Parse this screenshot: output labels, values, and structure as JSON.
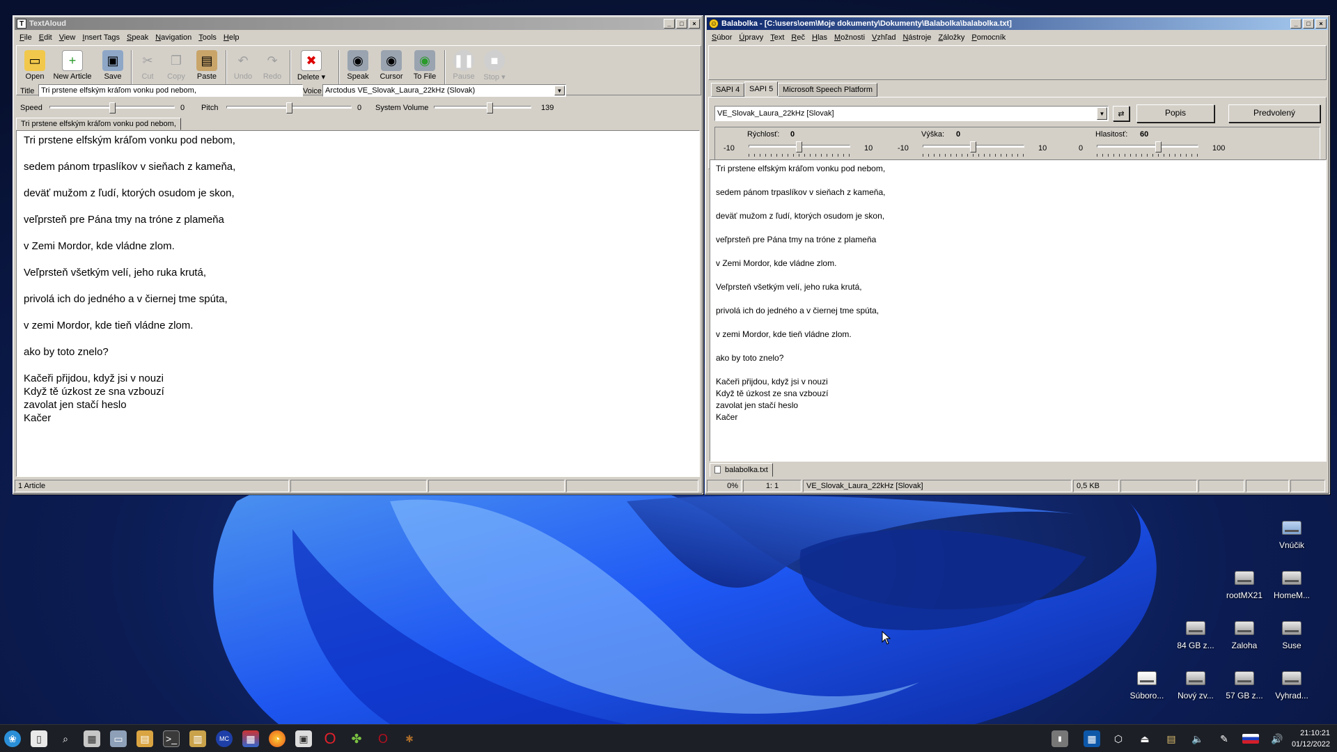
{
  "textaloud": {
    "title": "TextAloud",
    "menu": [
      "File",
      "Edit",
      "View",
      "Insert Tags",
      "Speak",
      "Navigation",
      "Tools",
      "Help"
    ],
    "toolbar": {
      "open": "Open",
      "new_article": "New Article",
      "save": "Save",
      "cut": "Cut",
      "copy": "Copy",
      "paste": "Paste",
      "undo": "Undo",
      "redo": "Redo",
      "delete": "Delete",
      "speak": "Speak",
      "cursor": "Cursor",
      "to_file": "To File",
      "pause": "Pause",
      "stop": "Stop"
    },
    "title_label": "Title",
    "title_value": "Tri prstene elfským kráľom vonku pod nebom,",
    "voice_label": "Voice",
    "voice_value": "Arctodus VE_Slovak_Laura_22kHz (Slovak)",
    "speed_label": "Speed",
    "speed_value": "0",
    "pitch_label": "Pitch",
    "pitch_value": "0",
    "volume_label": "System Volume",
    "volume_value": "139",
    "article_tab": "Tri prstene elfským kráľom vonku pod nebom,",
    "status": "1 Article"
  },
  "balabolka": {
    "title": "Balabolka - [C:\\users\\oem\\Moje dokumenty\\Dokumenty\\Balabolka\\balabolka.txt]",
    "menu": [
      "Súbor",
      "Úpravy",
      "Text",
      "Reč",
      "Hlas",
      "Možnosti",
      "Vzhľad",
      "Nástroje",
      "Záložky",
      "Pomocník"
    ],
    "tabs": [
      "SAPI 4",
      "SAPI 5",
      "Microsoft Speech Platform"
    ],
    "selected_tab": "SAPI 5",
    "voice_value": "VE_Slovak_Laura_22kHz [Slovak]",
    "popis": "Popis",
    "predvoleny": "Predvolený",
    "rychlost_label": "Rýchlosť:",
    "rychlost_value": "0",
    "rychlost_min": "-10",
    "rychlost_max": "10",
    "vyska_label": "Výška:",
    "vyska_value": "0",
    "vyska_min": "-10",
    "vyska_max": "10",
    "hlasitost_label": "Hlasitosť:",
    "hlasitost_value": "60",
    "hlasitost_min": "0",
    "hlasitost_max": "100",
    "doc_tab": "balabolka.txt",
    "status": {
      "percent": "0%",
      "position": "1:   1",
      "voice": "VE_Slovak_Laura_22kHz [Slovak]",
      "size": "0,5 KB"
    }
  },
  "poem": [
    "Tri prstene elfským kráľom vonku pod nebom,",
    "",
    "sedem pánom trpaslíkov v sieňach z kameňa,",
    "",
    "deväť mužom z ľudí, ktorých osudom je skon,",
    "",
    "veľprsteň pre Pána tmy na tróne z plameňa",
    "",
    "v Zemi Mordor, kde vládne zlom.",
    "",
    "Veľprsteň všetkým velí, jeho ruka krutá,",
    "",
    "privolá ich do jedného a v čiernej tme spúta,",
    "",
    "v zemi Mordor, kde tieň vládne zlom.",
    "",
    "ako by toto znelo?",
    "",
    "Kačeři přijdou, když jsi v nouzi",
    "Když tě úzkost ze sna vzbouzí",
    "zavolat jen stačí heslo",
    "Kačer"
  ],
  "desktop_icons": [
    "Vnúčik",
    "rootMX21",
    "HomeM...",
    "84 GB z...",
    "Zaloha",
    "Suse",
    "Súboro...",
    "Nový zv...",
    "57 GB z...",
    "Vyhrad..."
  ],
  "clock": {
    "time": "21:10:21",
    "date": "01/12/2022"
  }
}
